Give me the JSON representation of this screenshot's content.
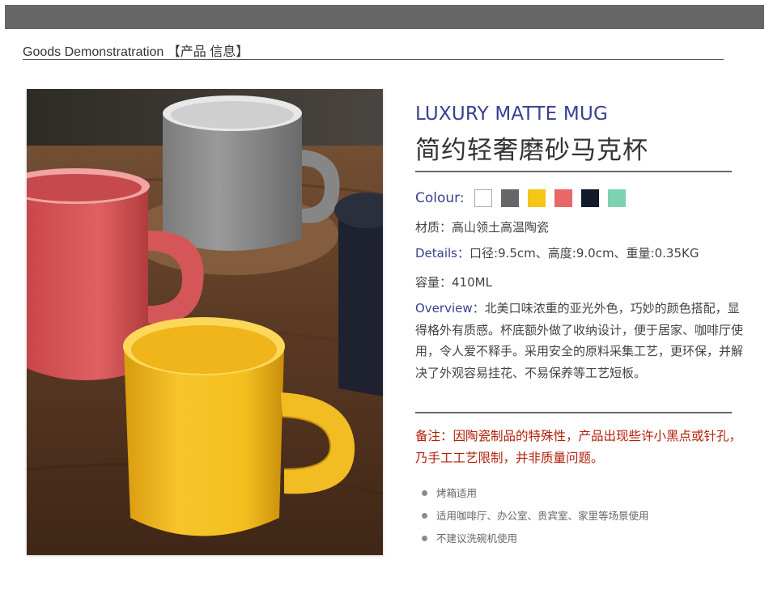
{
  "header": {
    "section_title": "Goods Demonstratration 【产品 信息】"
  },
  "product": {
    "title_en": "LUXURY MATTE MUG",
    "title_cn": "简约轻奢磨砂马克杯",
    "colour_label": "Colour:",
    "colours": [
      "#ffffff",
      "#666666",
      "#f5c518",
      "#e8686a",
      "#0f1a2b",
      "#7fd1b4"
    ],
    "material_label": "材质：",
    "material_value": "高山领土高温陶瓷",
    "details_label": "Details：",
    "details_value": "口径:9.5cm、高度:9.0cm、重量:0.35KG",
    "capacity_label": "容量：",
    "capacity_value": "410ML",
    "overview_label": "Overview：",
    "overview_text": "北美口味浓重的亚光外色，巧妙的颜色搭配，显得格外有质感。杯底额外做了收纳设计，便于居家、咖啡厅使用，令人爱不释手。采用安全的原料采集工艺，更环保，并解决了外观容易挂花、不易保养等工艺短板。",
    "note_text": "备注：因陶瓷制品的特殊性，产品出现些许小黑点或针孔，乃手工工艺限制，并非质量问题。",
    "features": [
      "烤箱适用",
      "适用咖啡厅、办公室、贵宾室、家里等场景使用",
      "不建议洗碗机使用"
    ]
  }
}
